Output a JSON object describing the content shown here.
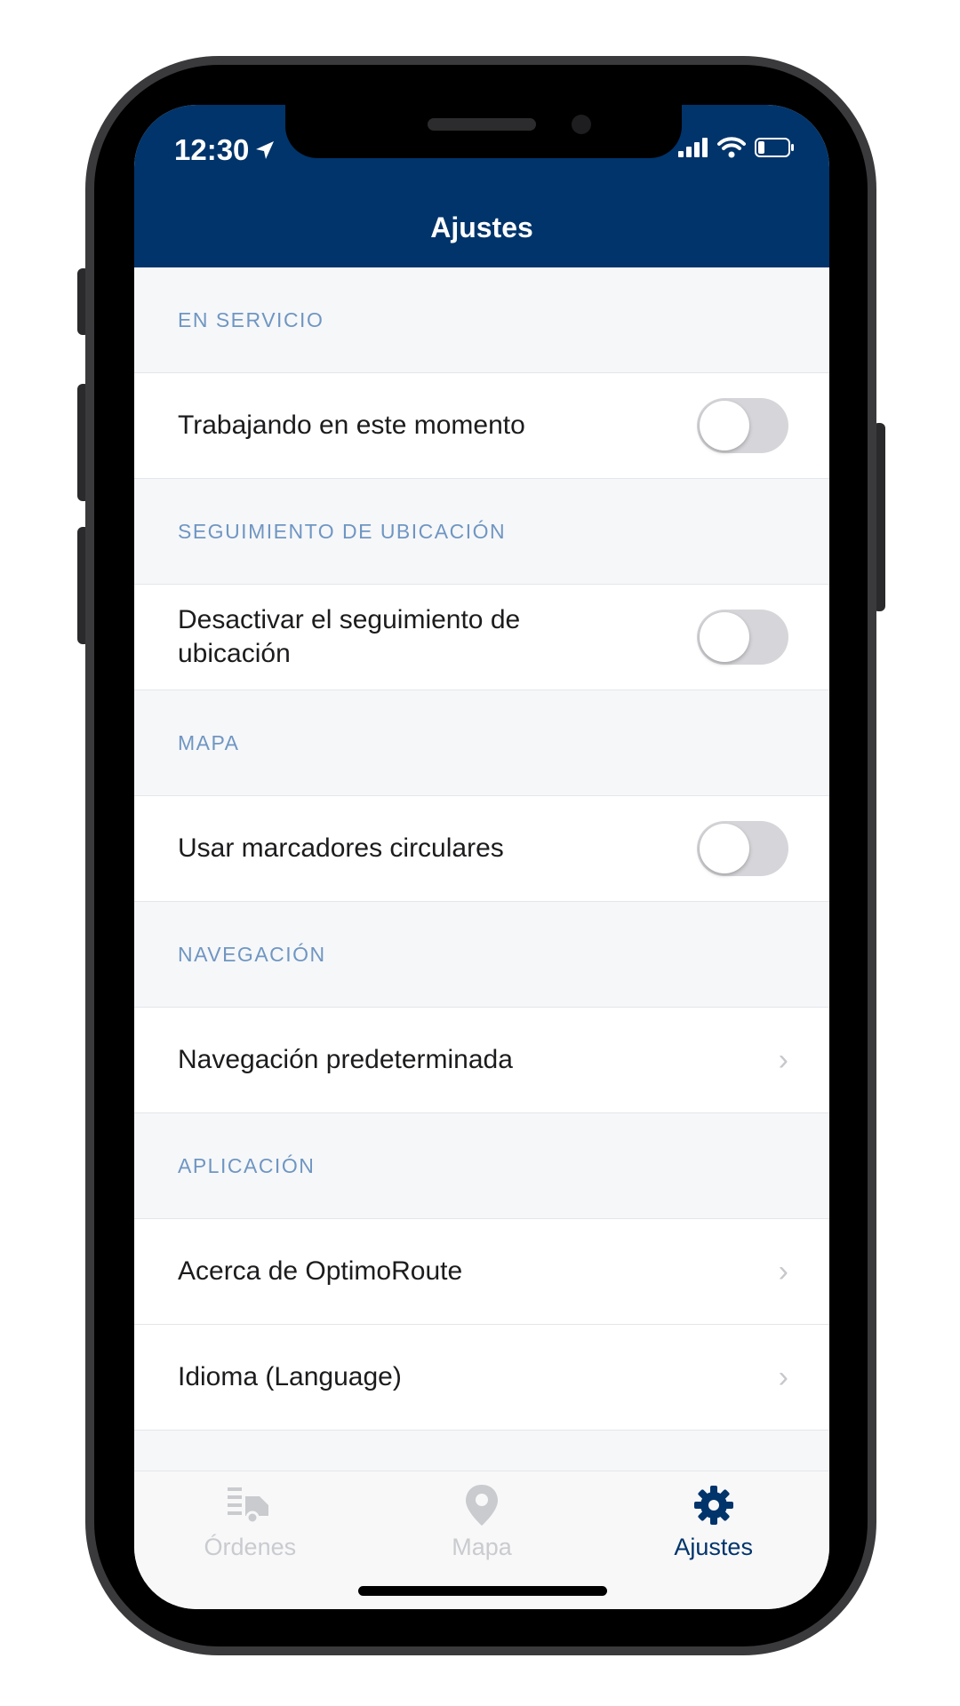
{
  "status_bar": {
    "time": "12:30"
  },
  "header": {
    "title": "Ajustes"
  },
  "sections": [
    {
      "header": "EN SERVICIO",
      "rows": [
        {
          "label": "Trabajando en este momento",
          "control": "toggle",
          "on": false
        }
      ]
    },
    {
      "header": "SEGUIMIENTO DE UBICACIÓN",
      "rows": [
        {
          "label": "Desactivar el seguimiento de ubicación",
          "control": "toggle",
          "on": false
        }
      ]
    },
    {
      "header": "MAPA",
      "rows": [
        {
          "label": "Usar marcadores circulares",
          "control": "toggle",
          "on": false
        }
      ]
    },
    {
      "header": "NAVEGACIÓN",
      "rows": [
        {
          "label": "Navegación predeterminada",
          "control": "chevron"
        }
      ]
    },
    {
      "header": "APLICACIÓN",
      "rows": [
        {
          "label": "Acerca de OptimoRoute",
          "control": "chevron"
        },
        {
          "label": "Idioma (Language)",
          "control": "chevron"
        }
      ]
    }
  ],
  "tab_bar": {
    "tabs": [
      {
        "label": "Órdenes",
        "icon": "orders-truck-icon",
        "active": false
      },
      {
        "label": "Mapa",
        "icon": "map-pin-icon",
        "active": false
      },
      {
        "label": "Ajustes",
        "icon": "gear-icon",
        "active": true
      }
    ]
  },
  "colors": {
    "header_bg": "#00346b",
    "section_text": "#6f96c2",
    "active_tab": "#00346b",
    "inactive_tab": "#c9cbcf"
  }
}
